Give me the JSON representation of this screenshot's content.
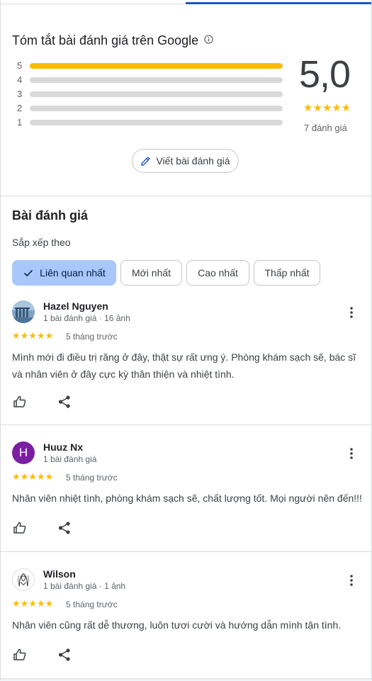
{
  "summary": {
    "title": "Tóm tắt bài đánh giá trên Google",
    "score": "5,0",
    "stars": "★★★★★",
    "count_label": "7 đánh giá",
    "histogram": [
      {
        "label": "5",
        "fraction": 1.0
      },
      {
        "label": "4",
        "fraction": 0.0
      },
      {
        "label": "3",
        "fraction": 0.0
      },
      {
        "label": "2",
        "fraction": 0.0
      },
      {
        "label": "1",
        "fraction": 0.0
      }
    ],
    "write_review_label": "Viết bài đánh giá"
  },
  "reviews_section": {
    "title": "Bài đánh giá",
    "sort_label": "Sắp xếp theo",
    "sort_chips": [
      {
        "label": "Liên quan nhất",
        "selected": true
      },
      {
        "label": "Mới nhất",
        "selected": false
      },
      {
        "label": "Cao nhất",
        "selected": false
      },
      {
        "label": "Thấp nhất",
        "selected": false
      }
    ]
  },
  "reviews": [
    {
      "name": "Hazel Nguyen",
      "meta": "1 bài đánh giá · 16 ảnh",
      "avatar": "photo-avatar",
      "stars": "★★★★★",
      "time": "5 tháng trước",
      "text": "Mình mới đi điều trị răng ở đây, thật sự rất ưng ý. Phòng khám sạch sẽ, bác sĩ và nhân viên ở đây cực kỳ thân thiện và nhiệt tình."
    },
    {
      "name": "Huuz Nx",
      "meta": "1 bài đánh giá",
      "avatar": "H",
      "avatar_color": "#7b1fa2",
      "stars": "★★★★★",
      "time": "5 tháng trước",
      "text": "Nhân viên nhiệt tình, phòng khám sạch sẽ, chất lượng tốt. Mọi người nên đến!!!"
    },
    {
      "name": "Wilson",
      "meta": "1 bài đánh giá · 1 ảnh",
      "avatar": "sketch-avatar",
      "stars": "★★★★★",
      "time": "5 tháng trước",
      "text": "Nhân viên cũng rất dễ thương, luôn tươi cười và hướng dẫn mình tận tình."
    }
  ],
  "colors": {
    "star": "#fbbc04",
    "selected_chip": "#a8c7fa",
    "accent": "#1a57c6"
  }
}
